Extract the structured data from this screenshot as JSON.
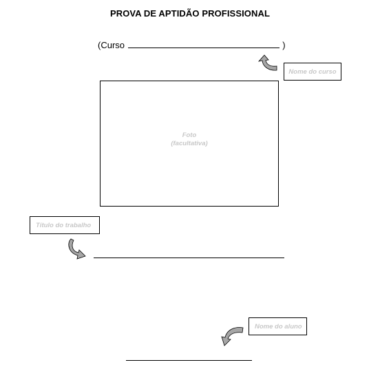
{
  "document": {
    "title": "PROVA DE APTIDÃO PROFISSIONAL",
    "course_prefix": "(Curso",
    "course_suffix": ")"
  },
  "photo": {
    "line1": "Foto",
    "line2": "(facultativa)"
  },
  "callouts": {
    "course_name": "Nome do curso",
    "work_title": "Título do trabalho",
    "student_name": "Nome do aluno"
  },
  "colors": {
    "arrow_fill": "#a6a6a6",
    "placeholder_text": "#c8c8c8"
  },
  "icons": {
    "curved_arrow": "curved-arrow-icon"
  }
}
